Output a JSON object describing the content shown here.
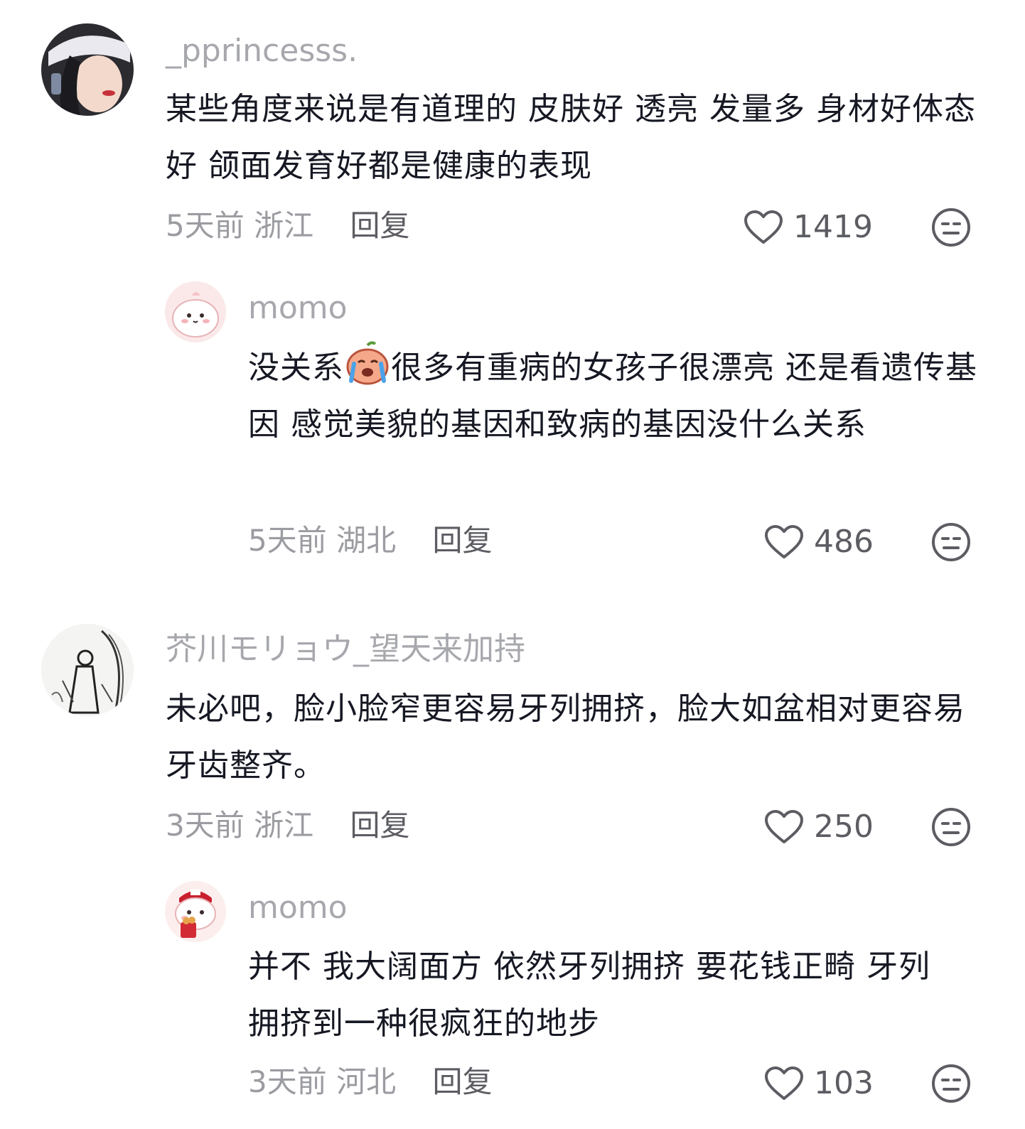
{
  "comments": [
    {
      "username": "_pprincesss.",
      "text": "某些角度来说是有道理的 皮肤好 透亮 发量多 身材好体态好 颌面发育好都是健康的表现",
      "time": "5天前",
      "location": "浙江",
      "reply_label": "回复",
      "likes": "1419"
    },
    {
      "username": "momo",
      "text_before_emoji": "没关系",
      "emoji": "crying-peach-emoji",
      "text_after_emoji": "很多有重病的女孩子很漂亮 还是看遗传基因 感觉美貌的基因和致病的基因没什么关系",
      "time": "5天前",
      "location": "湖北",
      "reply_label": "回复",
      "likes": "486"
    },
    {
      "username": "芥川モリョウ_望天来加持",
      "text": "未必吧，脸小脸窄更容易牙列拥挤，脸大如盆相对更容易牙齿整齐。",
      "time": "3天前",
      "location": "浙江",
      "reply_label": "回复",
      "likes": "250"
    },
    {
      "username": "momo",
      "text": "并不 我大阔面方 依然牙列拥挤 要花钱正畸 牙列拥挤到一种很疯狂的地步",
      "time": "3天前",
      "location": "河北",
      "reply_label": "回复",
      "likes": "103"
    }
  ],
  "icons": {
    "like": "heart-outline-icon",
    "dislike": "meh-face-icon"
  },
  "colors": {
    "username": "#a7a8ad",
    "text": "#161823",
    "meta": "#9b9ca1"
  }
}
